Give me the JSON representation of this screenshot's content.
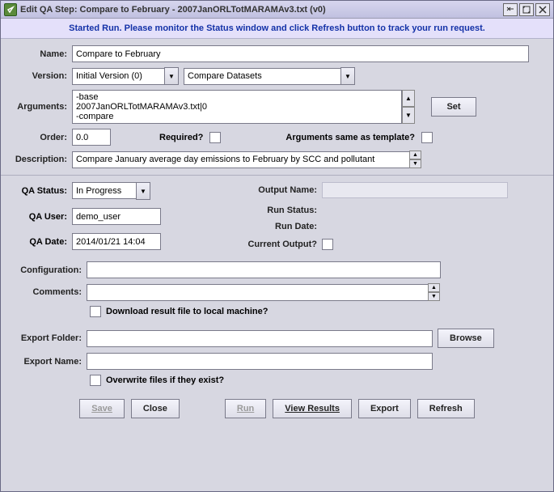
{
  "title": "Edit QA Step: Compare to February - 2007JanORLTotMARAMAv3.txt (v0)",
  "banner": "Started Run. Please monitor the Status window and click Refresh button to track your run request.",
  "labels": {
    "name": "Name:",
    "version": "Version:",
    "arguments": "Arguments:",
    "order": "Order:",
    "required": "Required?",
    "args_same": "Arguments same as template?",
    "description": "Description:",
    "qa_status": "QA Status:",
    "qa_user": "QA User:",
    "qa_date": "QA Date:",
    "output_name": "Output Name:",
    "run_status": "Run Status:",
    "run_date": "Run Date:",
    "current_output": "Current Output?",
    "configuration": "Configuration:",
    "comments": "Comments:",
    "download": "Download result file to local machine?",
    "export_folder": "Export Folder:",
    "export_name": "Export Name:",
    "overwrite": "Overwrite files if they exist?"
  },
  "fields": {
    "name": "Compare to February",
    "version": "Initial Version (0)",
    "program": "Compare Datasets",
    "arguments": "-base\n2007JanORLTotMARAMAv3.txt|0\n-compare",
    "order": "0.0",
    "description": "Compare January average day emissions to February by SCC and pollutant",
    "qa_status": "In Progress",
    "qa_user": "demo_user",
    "qa_date": "2014/01/21 14:04",
    "configuration": "",
    "comments": "",
    "export_folder": "",
    "export_name": ""
  },
  "buttons": {
    "set": "Set",
    "save": "Save",
    "close": "Close",
    "run": "Run",
    "view_results": "View Results",
    "export": "Export",
    "refresh": "Refresh",
    "browse": "Browse"
  }
}
